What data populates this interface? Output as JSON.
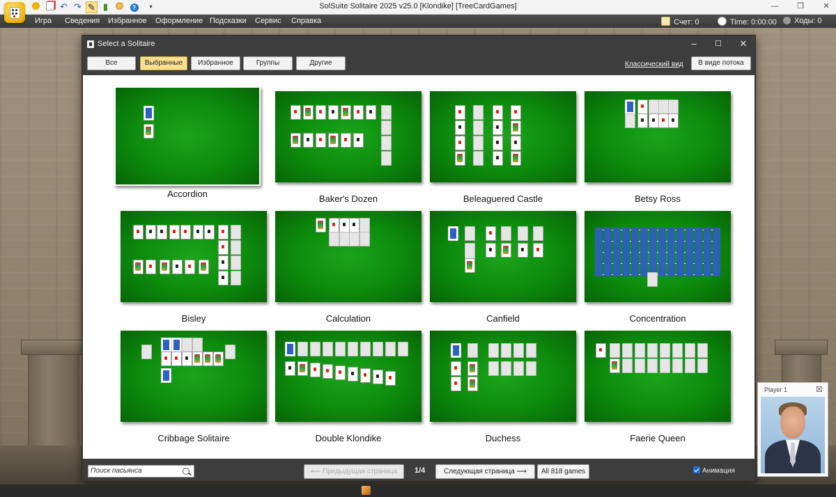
{
  "window": {
    "title": "SolSuite Solitaire 2025 v25.0  [Klondike]  [TreeCardGames]"
  },
  "menu": [
    "Игра",
    "Сведения",
    "Избранное",
    "Оформление",
    "Подсказки",
    "Сервис",
    "Справка"
  ],
  "stats": {
    "score": "Счет: 0",
    "time": "Time: 0:00:00",
    "moves": "Ходы: 0"
  },
  "dialog": {
    "title": "Select a Solitaire",
    "tabs": [
      "Все",
      "Выбранные",
      "Избранное",
      "Группы",
      "Другие"
    ],
    "active_tab": "Выбранные",
    "classic_view_link": "Классический вид",
    "flow_view_button": "В виде потока",
    "games": [
      "Accordion",
      "Baker's Dozen",
      "Beleaguered Castle",
      "Betsy Ross",
      "Bisley",
      "Calculation",
      "Canfield",
      "Concentration",
      "Cribbage Solitaire",
      "Double Klondike",
      "Duchess",
      "Faerie Queen"
    ],
    "search_placeholder": "Поиск пасьянса",
    "prev_page": "⟵  Предыдущая страница",
    "page_indicator": "1/4",
    "next_page": "Следующая страница  ⟶",
    "all_games": "All 818 games",
    "animation_label": "Анимация",
    "animation_checked": true
  },
  "player": {
    "name": "Player 1",
    "close_symbol": "☒"
  },
  "colors": {
    "felt": "#0c8a0c",
    "active_tab": "#fce08f",
    "dialog_bg": "#3d3d3d",
    "menubar": "#444444",
    "checkbox": "#1f6fd1"
  },
  "icons": {
    "app": "dice-app-icon",
    "quick_access": [
      "new-game-icon",
      "cards-icon",
      "undo-icon",
      "redo-icon",
      "pencil-icon",
      "stats-icon",
      "appearance-icon",
      "help-icon",
      "dropdown-icon"
    ],
    "stats": [
      "score-icon",
      "clock-icon",
      "moves-icon"
    ]
  }
}
